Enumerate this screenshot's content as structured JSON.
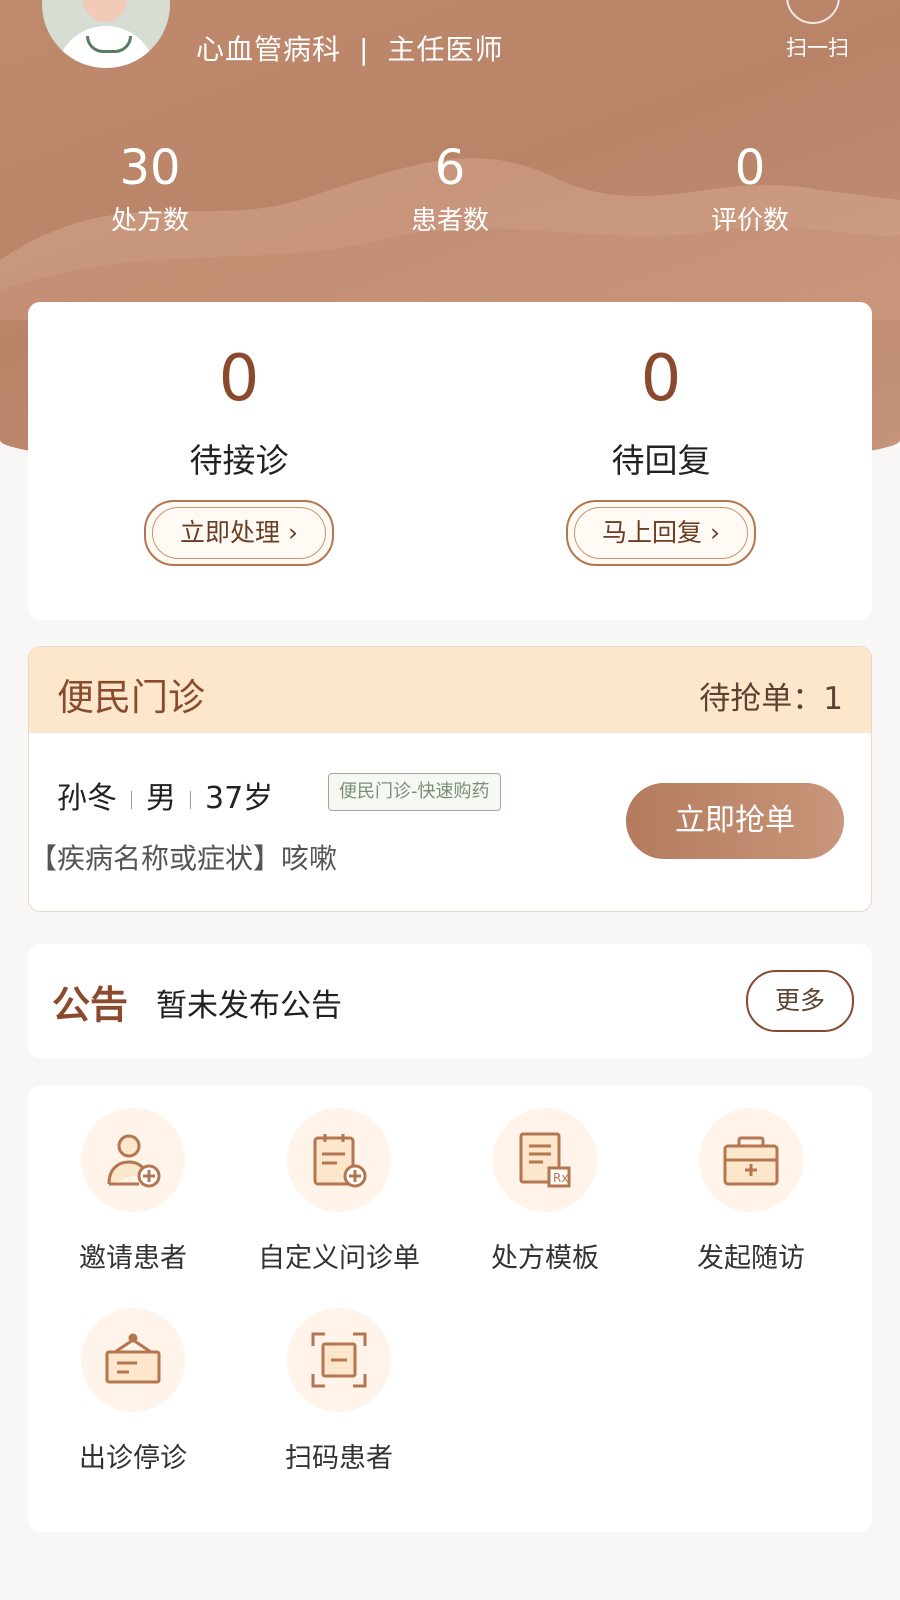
{
  "header": {
    "department": "心血管病科",
    "title": "主任医师",
    "scan_label": "扫一扫"
  },
  "stats": [
    {
      "value": "30",
      "label": "处方数"
    },
    {
      "value": "6",
      "label": "患者数"
    },
    {
      "value": "0",
      "label": "评价数"
    }
  ],
  "tasks": {
    "pending_consult": {
      "value": "0",
      "label": "待接诊",
      "button": "立即处理 ›"
    },
    "pending_reply": {
      "value": "0",
      "label": "待回复",
      "button": "马上回复 ›"
    }
  },
  "clinic": {
    "title": "便民门诊",
    "waiting": "待抢单：1",
    "patient": {
      "name": "孙冬",
      "gender": "男",
      "age": "37岁"
    },
    "tag": "便民门诊-快速购药",
    "symptom": "【疾病名称或症状】咳嗽",
    "grab_button": "立即抢单"
  },
  "notice": {
    "title": "公告",
    "text": "暂未发布公告",
    "more": "更多"
  },
  "tools": [
    {
      "label": "邀请患者",
      "icon": "invite-patient-icon"
    },
    {
      "label": "自定义问诊单",
      "icon": "custom-form-icon"
    },
    {
      "label": "处方模板",
      "icon": "prescription-template-icon"
    },
    {
      "label": "发起随访",
      "icon": "follow-up-icon"
    },
    {
      "label": "出诊停诊",
      "icon": "clinic-status-icon"
    },
    {
      "label": "扫码患者",
      "icon": "scan-patient-icon"
    }
  ],
  "colors": {
    "brand": "#b98368",
    "accent": "#8a4a2d",
    "banner": "#fde7cc"
  }
}
